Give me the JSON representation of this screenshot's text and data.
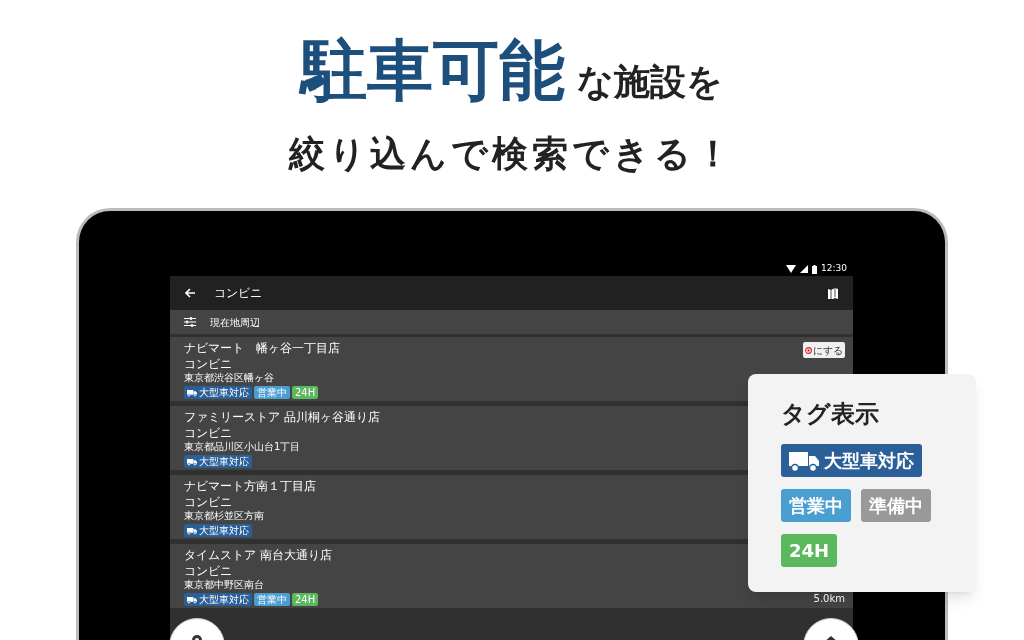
{
  "headline": {
    "emphasis": "駐車可能",
    "rest": "な施設を",
    "line2": "絞り込んで検索できる！"
  },
  "status_bar": {
    "time": "12:30"
  },
  "toolbar": {
    "title": "コンビニ"
  },
  "filter": {
    "label": "現在地周辺"
  },
  "stores": [
    {
      "name": "ナビマート　幡ヶ谷一丁目店",
      "category": "コンビニ",
      "address": "東京都渋谷区幡ヶ谷",
      "tags": [
        {
          "kind": "large_vehicle",
          "label": "大型車対応"
        },
        {
          "kind": "open",
          "label": "営業中"
        },
        {
          "kind": "h24",
          "label": "24H"
        }
      ],
      "action": "にする"
    },
    {
      "name": "ファミリーストア 品川桐ヶ谷通り店",
      "category": "コンビニ",
      "address": "東京都品川区小山台1丁目",
      "tags": [
        {
          "kind": "large_vehicle",
          "label": "大型車対応"
        }
      ]
    },
    {
      "name": "ナビマート方南１丁目店",
      "category": "コンビニ",
      "address": "東京都杉並区方南",
      "tags": [
        {
          "kind": "large_vehicle",
          "label": "大型車対応"
        }
      ]
    },
    {
      "name": "タイムストア 南台大通り店",
      "category": "コンビニ",
      "address": "東京都中野区南台",
      "tags": [
        {
          "kind": "large_vehicle",
          "label": "大型車対応"
        },
        {
          "kind": "open",
          "label": "営業中"
        },
        {
          "kind": "h24",
          "label": "24H"
        }
      ],
      "distance": "5.0km"
    }
  ],
  "legend": {
    "title": "タグ表示",
    "tags": [
      {
        "kind": "large_vehicle",
        "label": "大型車対応"
      },
      {
        "kind": "open",
        "label": "営業中"
      },
      {
        "kind": "preparing",
        "label": "準備中"
      },
      {
        "kind": "h24",
        "label": "24H"
      }
    ]
  }
}
